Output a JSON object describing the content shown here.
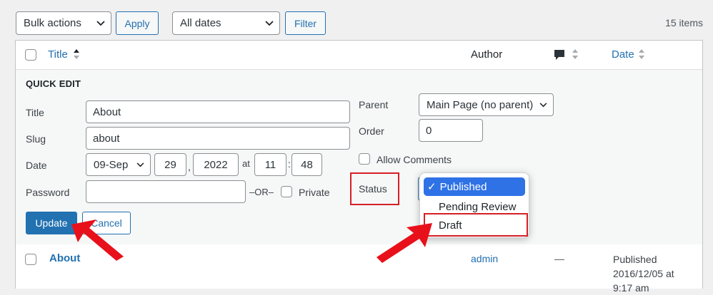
{
  "toolbar": {
    "bulk_actions": "Bulk actions",
    "apply": "Apply",
    "dates": "All dates",
    "filter": "Filter",
    "items_count": "15 items"
  },
  "table": {
    "headers": {
      "title": "Title",
      "author": "Author",
      "date": "Date"
    }
  },
  "quick_edit": {
    "heading": "QUICK EDIT",
    "title_label": "Title",
    "title_value": "About",
    "slug_label": "Slug",
    "slug_value": "about",
    "date_label": "Date",
    "date_month": "09-Sep",
    "date_day": "29",
    "date_comma": ",",
    "date_year": "2022",
    "date_at": "at",
    "date_hour": "11",
    "date_colon": ":",
    "date_minute": "48",
    "password_label": "Password",
    "password_value": "",
    "or_text": "–OR–",
    "private_label": "Private",
    "parent_label": "Parent",
    "parent_value": "Main Page (no parent)",
    "order_label": "Order",
    "order_value": "0",
    "allow_comments_label": "Allow Comments",
    "status_label": "Status",
    "status_options": [
      "Published",
      "Pending Review",
      "Draft"
    ],
    "status_checkmark": "✓",
    "update": "Update",
    "cancel": "Cancel"
  },
  "row": {
    "title": "About",
    "author": "admin",
    "comments": "—",
    "date_status": "Published",
    "date_value": "2016/12/05 at",
    "date_time": "9:17 am"
  },
  "colors": {
    "accent": "#2271b1",
    "annotation": "#e8101b"
  }
}
